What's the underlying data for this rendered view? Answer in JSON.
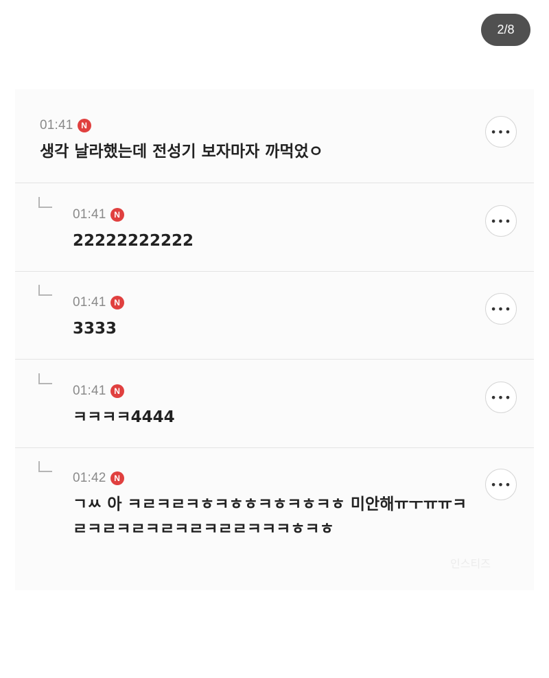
{
  "page_counter": "2/8",
  "new_badge_label": "N",
  "more_label": "•••",
  "comments": [
    {
      "time": "01:41",
      "text": "생각 날라했는데 전성기 보자마자 까먹었ㅇ"
    },
    {
      "time": "01:41",
      "text": "22222222222"
    },
    {
      "time": "01:41",
      "text": "3333"
    },
    {
      "time": "01:41",
      "text": "ㅋㅋㅋㅋ4444"
    },
    {
      "time": "01:42",
      "text": "ㄱㅆ 아 ㅋㄹㅋㄹㅋㅎㅋㅎㅎㅋㅎㅋㅎㅋㅎ 미안해ㅠㅜㅠㅠㅋㄹㅋㄹㅋㄹㅋㄹㅋㄹㅋㄹㄹㅋㅋㅋㅎㅋㅎ"
    }
  ],
  "watermark": "인스티즈"
}
